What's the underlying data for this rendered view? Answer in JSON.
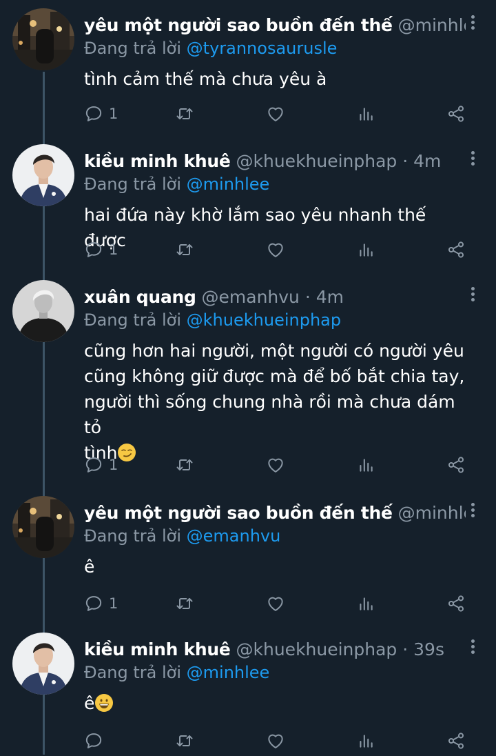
{
  "reply_prefix": "Đang trả lời",
  "tweets": [
    {
      "name": "yêu một người sao buồn đến thế",
      "handle_meta": "@minhlee ·...",
      "reply_to": "@tyrannosaurusle",
      "text": "tình cảm thế mà chưa yêu à",
      "reply_count": "1",
      "avatar": "city-photo-avatar"
    },
    {
      "name": "kiều minh khuê",
      "handle_meta": "@khuekhueinphap · 4m",
      "reply_to": "@minhlee",
      "text": "hai đứa này khờ lắm sao yêu nhanh thế được",
      "reply_count": "1",
      "avatar": "man-in-suit-avatar"
    },
    {
      "name": "xuân quang",
      "handle_meta": "@emanhvu · 4m",
      "reply_to": "@khuekhueinphap",
      "text_lines": [
        "cũng hơn hai người, một người có người yêu",
        "cũng không giữ được mà để bố bắt chia tay,",
        "người thì sống chung nhà rồi mà chưa dám tỏ",
        "tình"
      ],
      "text_emoji": "smirking-face-emoji",
      "reply_count": "1",
      "avatar": "bw-portrait-avatar"
    },
    {
      "name": "yêu một người sao buồn đến thế",
      "handle_meta": "@minhlee ·...",
      "reply_to": "@emanhvu",
      "text": "ê",
      "reply_count": "1",
      "avatar": "city-photo-avatar"
    },
    {
      "name": "kiều minh khuê",
      "handle_meta": "@khuekhueinphap · 39s",
      "reply_to": "@minhlee",
      "text": "ê",
      "text_emoji": "grinning-face-emoji",
      "reply_count": "",
      "avatar": "man-in-suit-avatar"
    }
  ],
  "colors": {
    "background": "#15202b",
    "secondary_text": "#8b98a5",
    "mention": "#1d9bf0",
    "thread_line": "#3d5466"
  }
}
